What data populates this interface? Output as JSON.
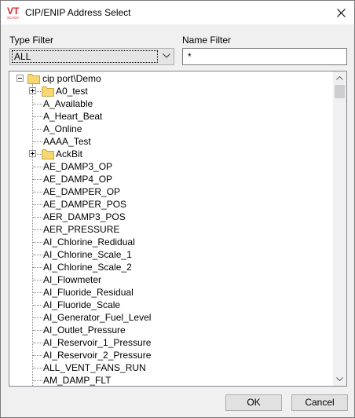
{
  "window": {
    "title": "CIP/ENIP Address Select",
    "logo_text": "VT",
    "logo_subtext": "SCADA"
  },
  "colors": {
    "logo_red": "#d9262b",
    "folder": "#f7d774",
    "folder_edge": "#c9a53a",
    "selection_bg": "#e5e5e5"
  },
  "type_filter": {
    "label": "Type Filter",
    "selected": "ALL"
  },
  "name_filter": {
    "label": "Name Filter",
    "value": "*"
  },
  "tree": {
    "root": "cip port\\Demo",
    "items": [
      {
        "label": "A0_test",
        "folder": true
      },
      {
        "label": "A_Available"
      },
      {
        "label": "A_Heart_Beat"
      },
      {
        "label": "A_Online"
      },
      {
        "label": "AAAA_Test"
      },
      {
        "label": "AckBit",
        "folder": true
      },
      {
        "label": "AE_DAMP3_OP"
      },
      {
        "label": "AE_DAMP4_OP"
      },
      {
        "label": "AE_DAMPER_OP"
      },
      {
        "label": "AE_DAMPER_POS"
      },
      {
        "label": "AER_DAMP3_POS"
      },
      {
        "label": "AER_PRESSURE"
      },
      {
        "label": "AI_Chlorine_Redidual"
      },
      {
        "label": "AI_Chlorine_Scale_1"
      },
      {
        "label": "AI_Chlorine_Scale_2"
      },
      {
        "label": "AI_Flowmeter"
      },
      {
        "label": "AI_Fluoride_Residual"
      },
      {
        "label": "AI_Fluoride_Scale"
      },
      {
        "label": "AI_Generator_Fuel_Level"
      },
      {
        "label": "AI_Outlet_Pressure"
      },
      {
        "label": "AI_Reservoir_1_Pressure"
      },
      {
        "label": "AI_Reservoir_2_Pressure"
      },
      {
        "label": "ALL_VENT_FANS_RUN"
      },
      {
        "label": "AM_DAMP_FLT"
      }
    ]
  },
  "buttons": {
    "ok": "OK",
    "cancel": "Cancel"
  }
}
